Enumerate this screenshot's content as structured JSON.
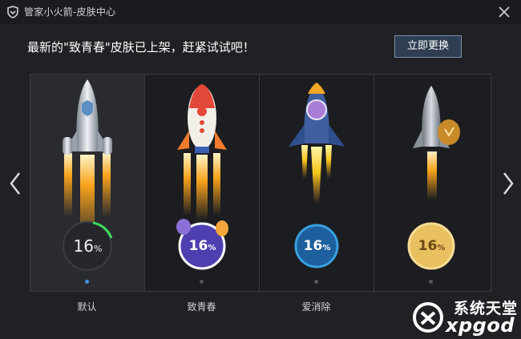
{
  "window": {
    "title": "管家小火箭-皮肤中心"
  },
  "banner": {
    "text": "最新的\"致青春\"皮肤已上架，赶紧试试吧！",
    "apply_label": "立即更换"
  },
  "skins": [
    {
      "label": "默认",
      "badge": "16",
      "badge_unit": "%",
      "selected": true
    },
    {
      "label": "致青春",
      "badge": "16",
      "badge_unit": "%",
      "selected": false
    },
    {
      "label": "爱消除",
      "badge": "16",
      "badge_unit": "%",
      "selected": false
    },
    {
      "label": "",
      "badge": "16",
      "badge_unit": "%",
      "selected": false
    }
  ],
  "watermark": {
    "line1": "系统天堂",
    "line2": "xpgod"
  },
  "colors": {
    "accent": "#3f94ea",
    "button_bg": "#2f3e52",
    "flame": "#f7a21b"
  }
}
